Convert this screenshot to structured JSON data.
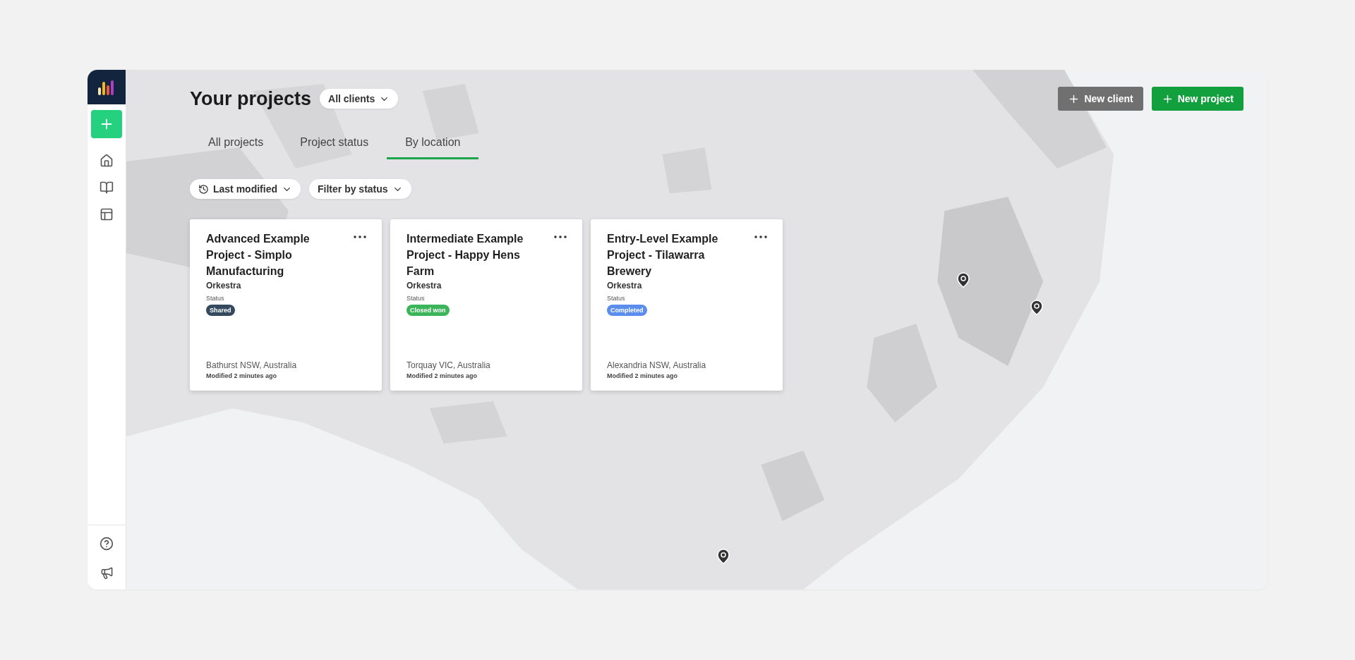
{
  "header": {
    "title": "Your projects",
    "client_filter": "All clients",
    "buttons": [
      {
        "label": "New client",
        "kind": "secondary"
      },
      {
        "label": "New project",
        "kind": "primary"
      }
    ]
  },
  "tabs": [
    {
      "label": "All projects",
      "selected": false
    },
    {
      "label": "Project status",
      "selected": false
    },
    {
      "label": "By location",
      "selected": true
    }
  ],
  "filters": [
    {
      "label": "Last modified",
      "kind": "sort"
    },
    {
      "label": "Filter by status",
      "kind": "filter"
    }
  ],
  "projects": [
    {
      "title": "Advanced Example Project - Simplo Manufacturing",
      "client": "Orkestra",
      "status_label": "Status",
      "status": "Shared",
      "color": "#34495e",
      "location": "Bathurst NSW, Australia",
      "modified": "Modified 2 minutes ago"
    },
    {
      "title": "Intermediate Example Project - Happy Hens Farm",
      "client": "Orkestra",
      "status_label": "Status",
      "status": "Closed won",
      "color": "#3cb55a",
      "location": "Torquay VIC, Australia",
      "modified": "Modified 2 minutes ago"
    },
    {
      "title": "Entry-Level Example Project - Tilawarra Brewery",
      "client": "Orkestra",
      "status_label": "Status",
      "status": "Completed",
      "color": "#5b8def",
      "location": "Alexandria NSW, Australia",
      "modified": "Modified 2 minutes ago"
    }
  ]
}
